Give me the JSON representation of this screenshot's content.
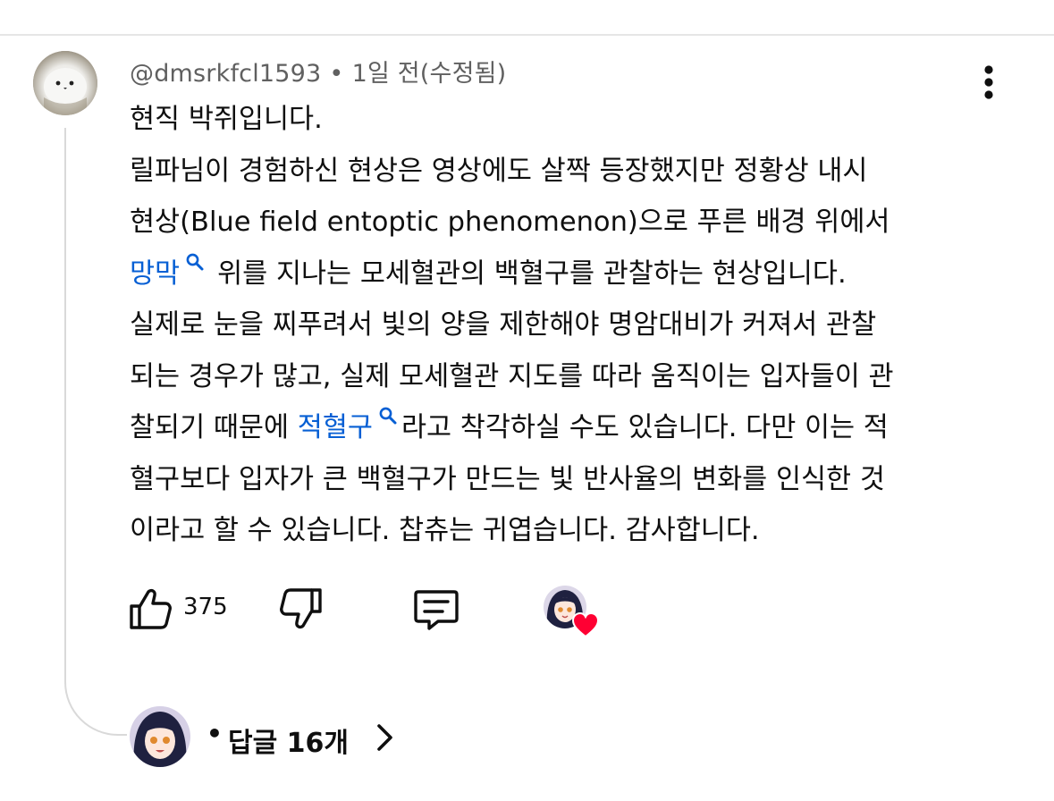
{
  "comment": {
    "author": "@dmsrkfcl1593",
    "separator": "•",
    "time": "1일 전(수정됨)",
    "lines": {
      "l1": "현직 박쥐입니다.",
      "l2": "릴파님이 경험하신 현상은 영상에도 살짝 등장했지만 정황상 내시",
      "l3": "현상(Blue field entoptic phenomenon)으로 푸른 배경 위에서",
      "l4_link": "망막",
      "l4_rest": "위를 지나는 모세혈관의 백혈구를 관찰하는 현상입니다.",
      "l5": "실제로 눈을 찌푸려서 빛의 양을 제한해야 명암대비가 커져서 관찰",
      "l6": "되는 경우가 많고, 실제 모세혈관 지도를 따라 움직이는 입자들이 관",
      "l7_pre": "찰되기 때문에",
      "l7_link": "적혈구",
      "l7_rest": "라고 착각하실 수도 있습니다. 다만 이는 적",
      "l8": "혈구보다 입자가 큰 백혈구가 만드는 빛 반사율의 변화를 인식한 것",
      "l9": "이라고 할 수 있습니다. 찹츄는 귀엽습니다. 감사합니다."
    }
  },
  "actions": {
    "like_count": "375"
  },
  "replies": {
    "separator": "•",
    "label": "답글 16개"
  },
  "colors": {
    "link": "#065fd4",
    "meta": "#606060",
    "heart": "#ff0033",
    "divider": "#e6e6e6"
  },
  "icons": {
    "more": "more-vert-icon",
    "search": "search-icon",
    "like": "thumbs-up-icon",
    "dislike": "thumbs-down-icon",
    "reply": "reply-comment-icon",
    "heart": "heart-icon",
    "chevron": "chevron-right-icon"
  }
}
